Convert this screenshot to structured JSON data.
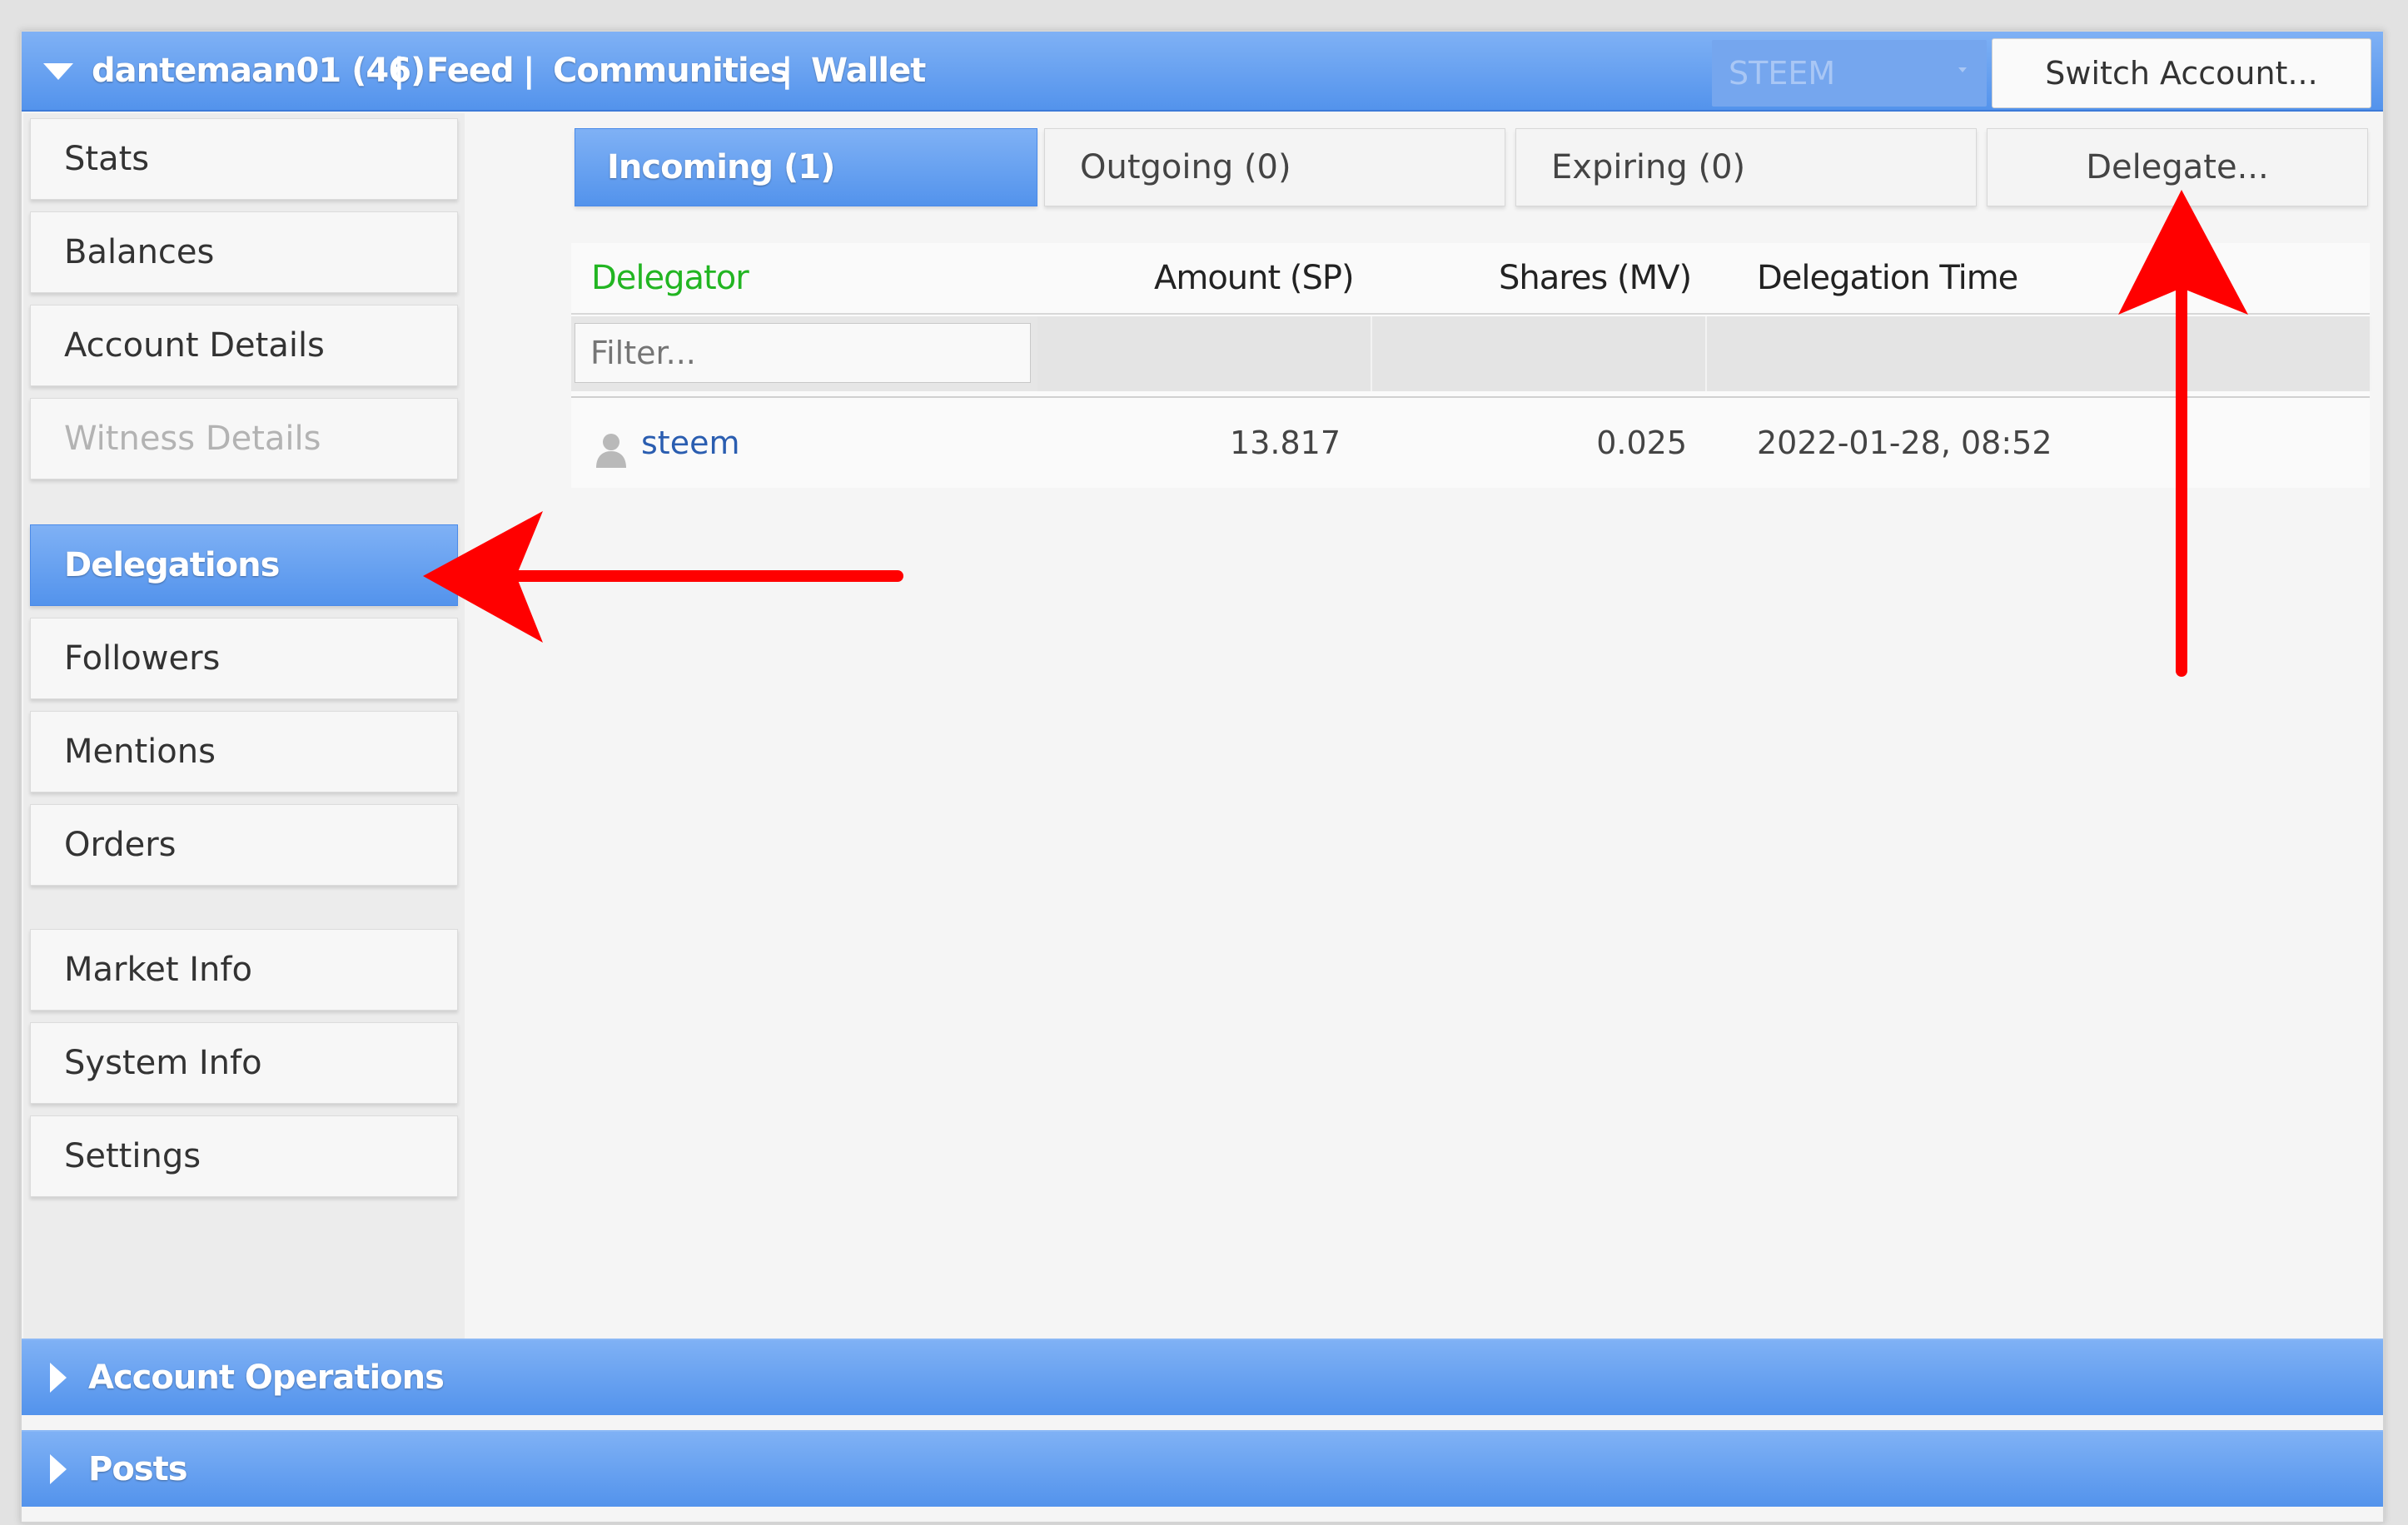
{
  "header": {
    "account": "dantemaan01 (46)",
    "nav": [
      "Feed",
      "Communities",
      "Wallet"
    ],
    "separator": "|",
    "currency": "STEEM",
    "switch_label": "Switch Account..."
  },
  "sidebar": {
    "items": [
      {
        "label": "Stats"
      },
      {
        "label": "Balances"
      },
      {
        "label": "Account Details"
      },
      {
        "label": "Witness Details"
      },
      {
        "label": "Delegations"
      },
      {
        "label": "Followers"
      },
      {
        "label": "Mentions"
      },
      {
        "label": "Orders"
      },
      {
        "label": "Market Info"
      },
      {
        "label": "System Info"
      },
      {
        "label": "Settings"
      }
    ],
    "active": "Delegations",
    "disabled": "Witness Details"
  },
  "tabs": {
    "incoming": "Incoming (1)",
    "outgoing": "Outgoing (0)",
    "expiring": "Expiring (0)",
    "delegate": "Delegate..."
  },
  "table": {
    "columns": [
      "Delegator",
      "Amount (SP)",
      "Shares (MV)",
      "Delegation Time"
    ],
    "filter_placeholder": "Filter...",
    "rows": [
      {
        "delegator": "steem",
        "amount": "13.817",
        "shares": "0.025",
        "time": "2022-01-28, 08:52"
      }
    ]
  },
  "footer": {
    "account_operations": "Account Operations",
    "posts": "Posts"
  },
  "colors": {
    "accent": "#5393ec",
    "delegator_header": "#22b522",
    "link": "#2a5db0",
    "annotation_arrow": "#ff0000"
  }
}
